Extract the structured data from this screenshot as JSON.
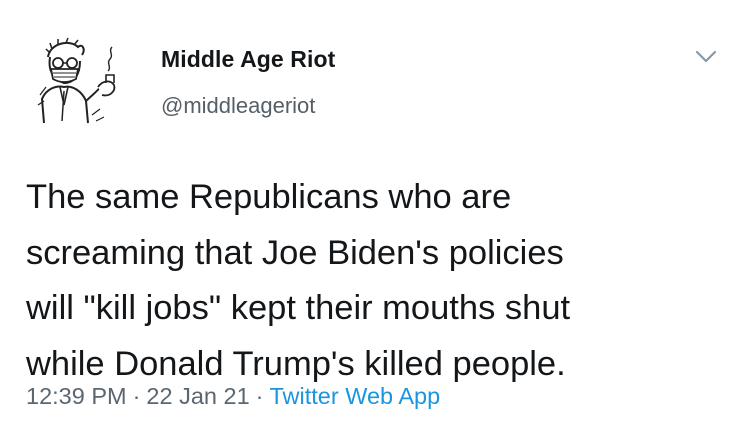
{
  "tweet": {
    "display_name": "Middle Age Riot",
    "handle": "@middleageriot",
    "text_lines": [
      "The same Republicans who are",
      "screaming that Joe Biden's policies",
      "will \"kill jobs\" kept their mouths shut",
      "while Donald Trump's killed people."
    ],
    "time": "12:39 PM",
    "separator": "·",
    "date": "22 Jan 21",
    "source": "Twitter Web App",
    "caret_icon": "chevron-down-icon",
    "avatar_icon": "masked-man-sketch-avatar",
    "link_color": "#1b95e0"
  }
}
